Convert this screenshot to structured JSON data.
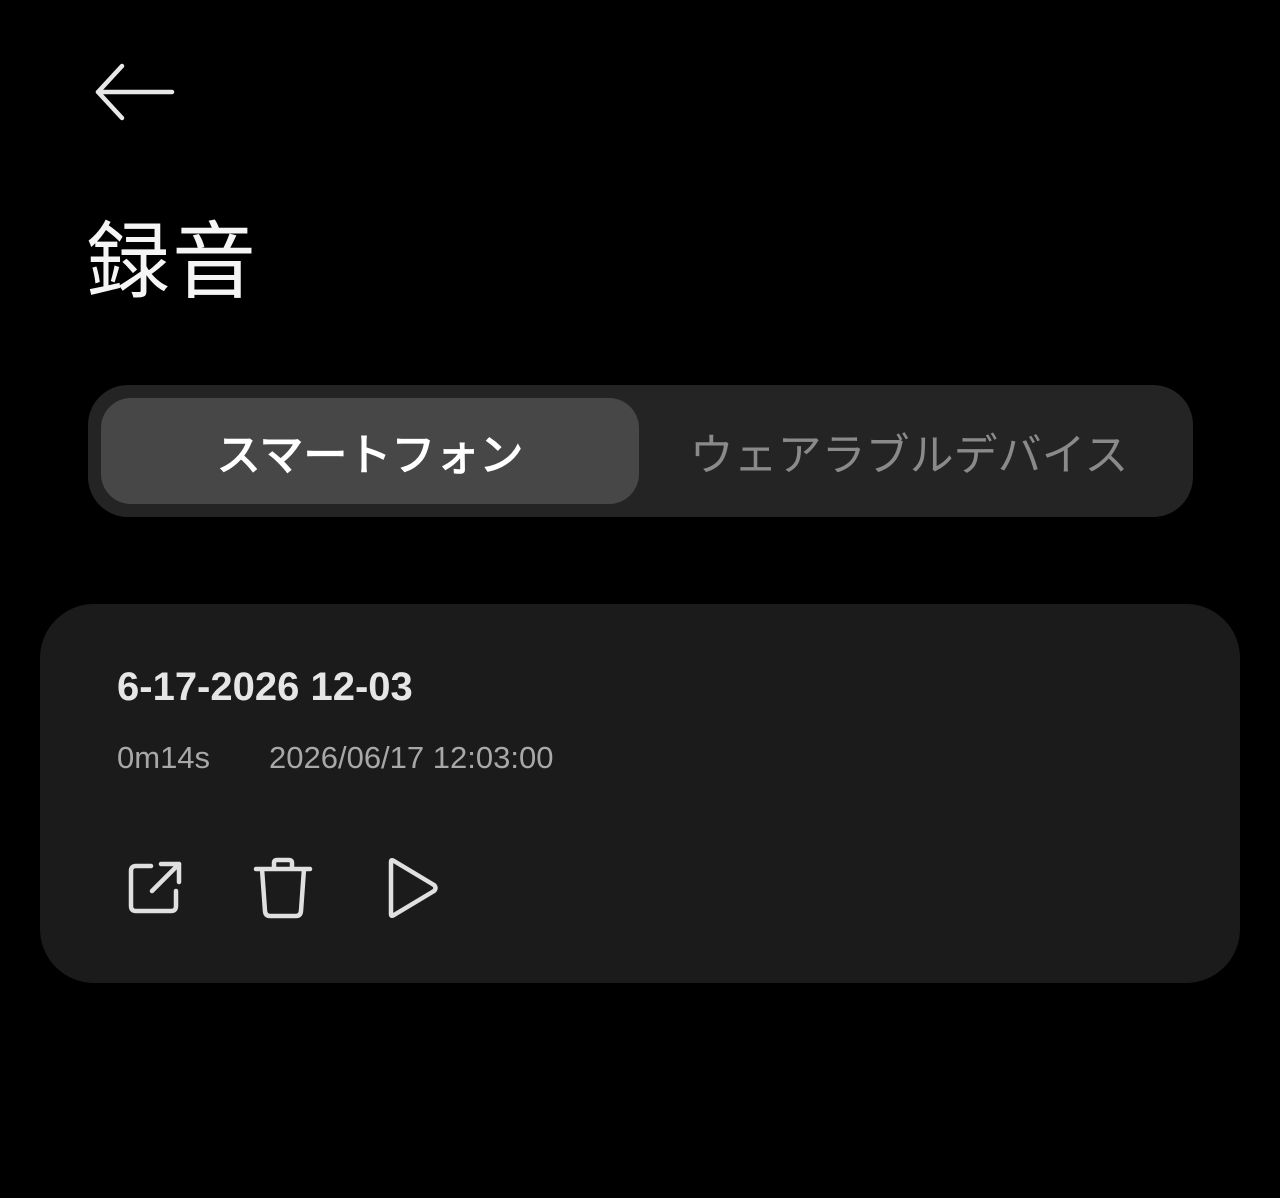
{
  "header": {
    "back_icon": "arrow-left-icon",
    "title": "録音"
  },
  "tabs": [
    {
      "label": "スマートフォン",
      "selected": true
    },
    {
      "label": "ウェアラブルデバイス",
      "selected": false
    }
  ],
  "recordings": [
    {
      "name": "6-17-2026 12-03",
      "duration": "0m14s",
      "datetime": "2026/06/17 12:03:00",
      "actions": [
        "share-icon",
        "trash-icon",
        "play-icon"
      ]
    }
  ],
  "colors": {
    "background": "#000000",
    "segment_track": "#242424",
    "segment_active": "#474747",
    "card": "#1b1b1b",
    "text_primary": "#e6e6e6",
    "text_secondary": "#a8a8a8",
    "text_inactive": "#8a8a8a"
  }
}
